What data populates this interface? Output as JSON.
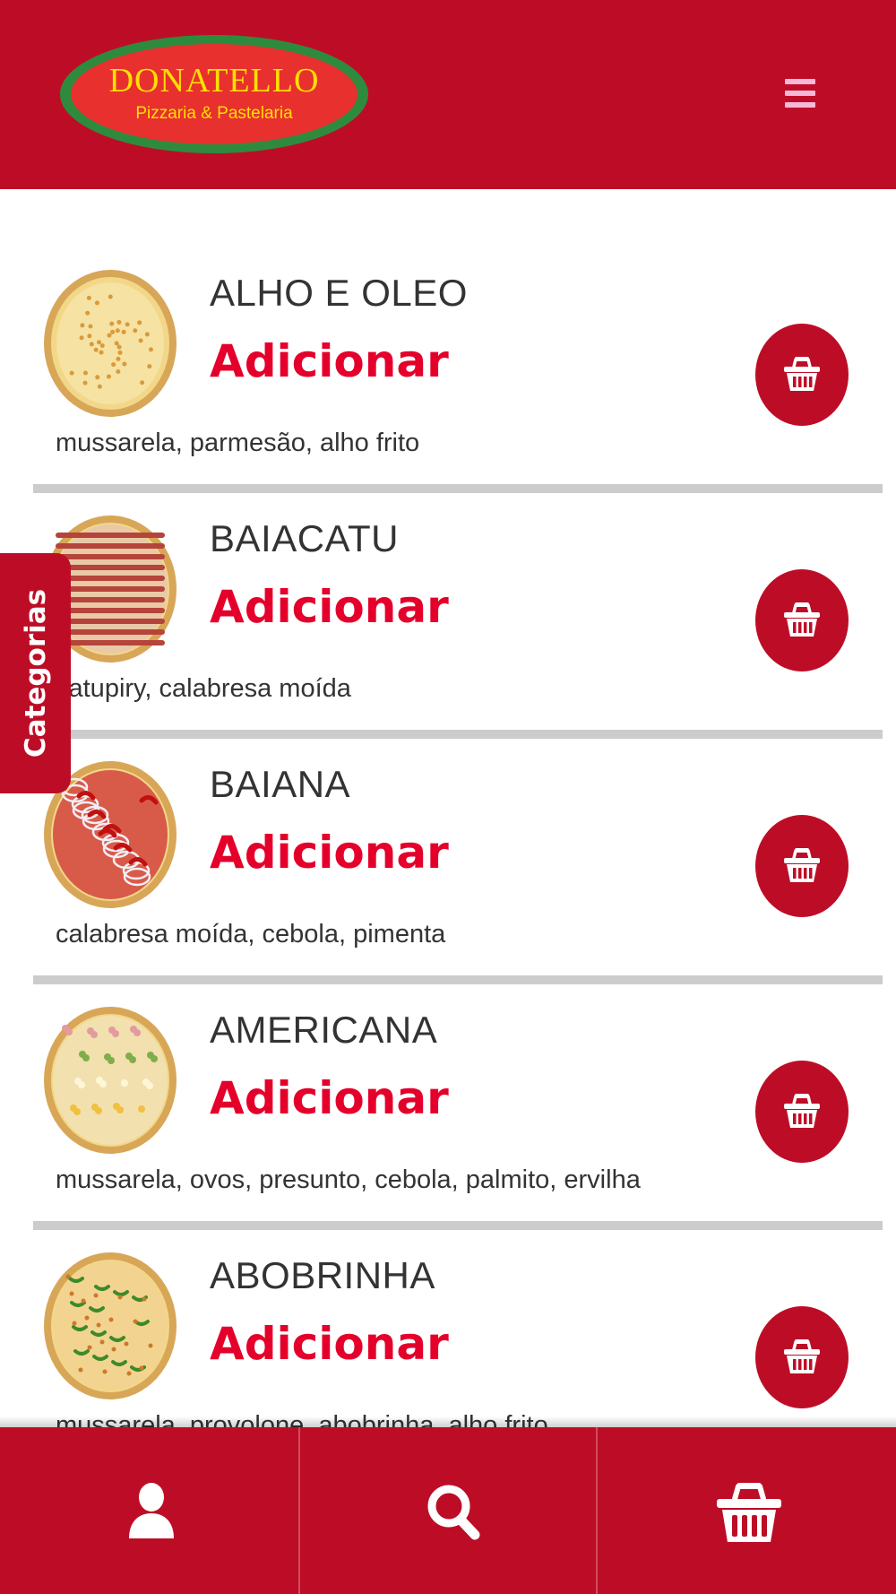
{
  "header": {
    "logo_title": "DONATELLO",
    "logo_subtitle": "Pizzaria & Pastelaria",
    "menu_icon": "hamburger-menu-icon"
  },
  "products": [
    {
      "name": "ALHO E OLEO",
      "add_label": "Adicionar",
      "description": "mussarela, parmesão, alho frito",
      "topping": "cheese"
    },
    {
      "name": "BAIACATU",
      "add_label": "Adicionar",
      "description": "catupiry, calabresa moída",
      "topping": "stripes"
    },
    {
      "name": "BAIANA",
      "add_label": "Adicionar",
      "description": "calabresa moída, cebola, pimenta",
      "topping": "onion-pepper"
    },
    {
      "name": "AMERICANA",
      "add_label": "Adicionar",
      "description": "mussarela, ovos, presunto, cebola, palmito, ervilha",
      "topping": "mixed"
    },
    {
      "name": "ABOBRINHA",
      "add_label": "Adicionar",
      "description": "mussarela, provolone, abobrinha, alho frito",
      "topping": "zucchini"
    }
  ],
  "side_tab": {
    "label": "Categorias"
  },
  "bottom_nav": [
    {
      "icon": "user-icon"
    },
    {
      "icon": "search-icon"
    },
    {
      "icon": "basket-icon"
    }
  ],
  "colors": {
    "brand_red": "#bd0d26",
    "accent_red": "#e4002b",
    "logo_yellow": "#ffe000",
    "logo_green": "#2e8b3e"
  }
}
